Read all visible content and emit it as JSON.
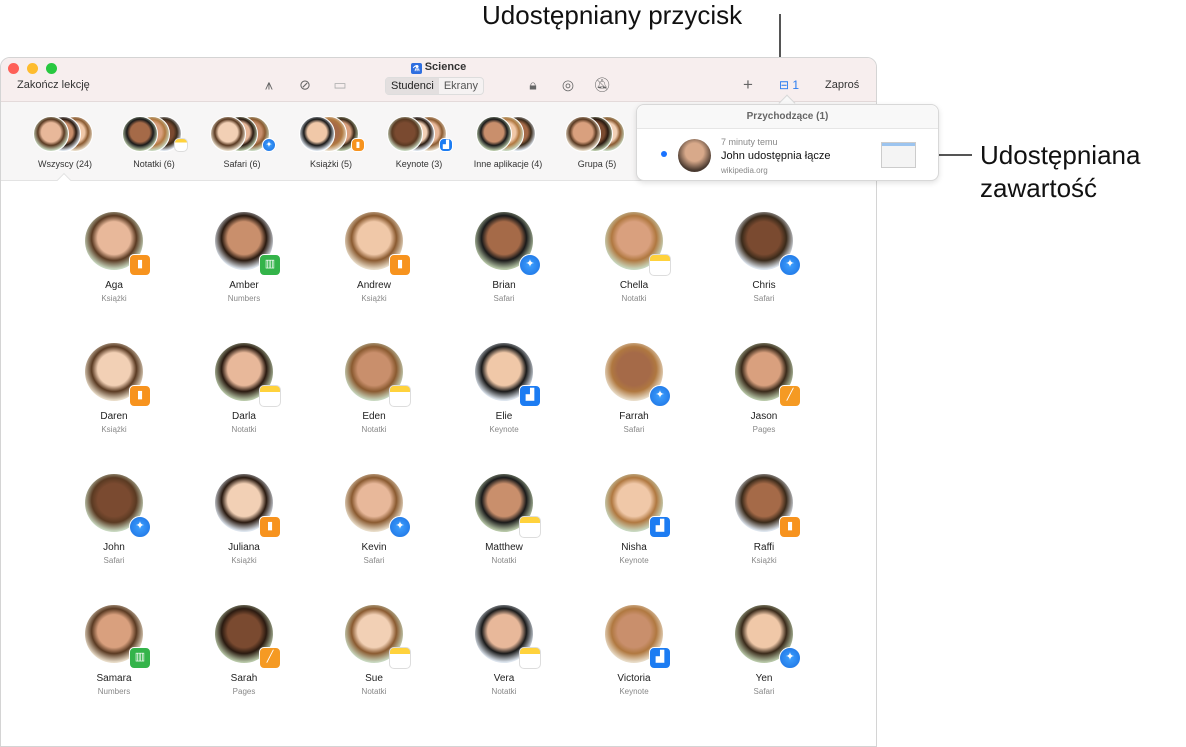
{
  "callouts": {
    "button": "Udostępniany przycisk",
    "content_line1": "Udostępniana",
    "content_line2": "zawartość"
  },
  "window": {
    "title": "Science",
    "end_lesson": "Zakończ lekcję",
    "segments": [
      "Studenci",
      "Ekrany"
    ],
    "inbox_count": "1",
    "invite": "Zaproś"
  },
  "groups": [
    {
      "label": "Wszyscy (24)",
      "badge": ""
    },
    {
      "label": "Notatki (6)",
      "badge": "notes"
    },
    {
      "label": "Safari (6)",
      "badge": "safari"
    },
    {
      "label": "Książki (5)",
      "badge": "books"
    },
    {
      "label": "Keynote (3)",
      "badge": "keynote"
    },
    {
      "label": "Inne aplikacje (4)",
      "badge": ""
    },
    {
      "label": "Grupa (5)",
      "badge": ""
    }
  ],
  "popover": {
    "title": "Przychodzące (1)",
    "time": "7 minuty temu",
    "message": "John udostępnia łącze",
    "source": "wikipedia.org"
  },
  "app_colors": {
    "books": "#f7931e",
    "numbers": "#34b44a",
    "keynote": "#1c7cf2",
    "pages": "#f59a23"
  },
  "students": [
    {
      "name": "Aga",
      "app": "Książki",
      "badge": "books"
    },
    {
      "name": "Amber",
      "app": "Numbers",
      "badge": "numbers"
    },
    {
      "name": "Andrew",
      "app": "Książki",
      "badge": "books"
    },
    {
      "name": "Brian",
      "app": "Safari",
      "badge": "safari"
    },
    {
      "name": "Chella",
      "app": "Notatki",
      "badge": "notes"
    },
    {
      "name": "Chris",
      "app": "Safari",
      "badge": "safari"
    },
    {
      "name": "Daren",
      "app": "Książki",
      "badge": "books"
    },
    {
      "name": "Darla",
      "app": "Notatki",
      "badge": "notes"
    },
    {
      "name": "Eden",
      "app": "Notatki",
      "badge": "notes"
    },
    {
      "name": "Elie",
      "app": "Keynote",
      "badge": "keynote"
    },
    {
      "name": "Farrah",
      "app": "Safari",
      "badge": "safari"
    },
    {
      "name": "Jason",
      "app": "Pages",
      "badge": "pages"
    },
    {
      "name": "John",
      "app": "Safari",
      "badge": "safari"
    },
    {
      "name": "Juliana",
      "app": "Książki",
      "badge": "books"
    },
    {
      "name": "Kevin",
      "app": "Safari",
      "badge": "safari"
    },
    {
      "name": "Matthew",
      "app": "Notatki",
      "badge": "notes"
    },
    {
      "name": "Nisha",
      "app": "Keynote",
      "badge": "keynote"
    },
    {
      "name": "Raffi",
      "app": "Książki",
      "badge": "books"
    },
    {
      "name": "Samara",
      "app": "Numbers",
      "badge": "numbers"
    },
    {
      "name": "Sarah",
      "app": "Pages",
      "badge": "pages"
    },
    {
      "name": "Sue",
      "app": "Notatki",
      "badge": "notes"
    },
    {
      "name": "Vera",
      "app": "Notatki",
      "badge": "notes"
    },
    {
      "name": "Victoria",
      "app": "Keynote",
      "badge": "keynote"
    },
    {
      "name": "Yen",
      "app": "Safari",
      "badge": "safari"
    }
  ]
}
